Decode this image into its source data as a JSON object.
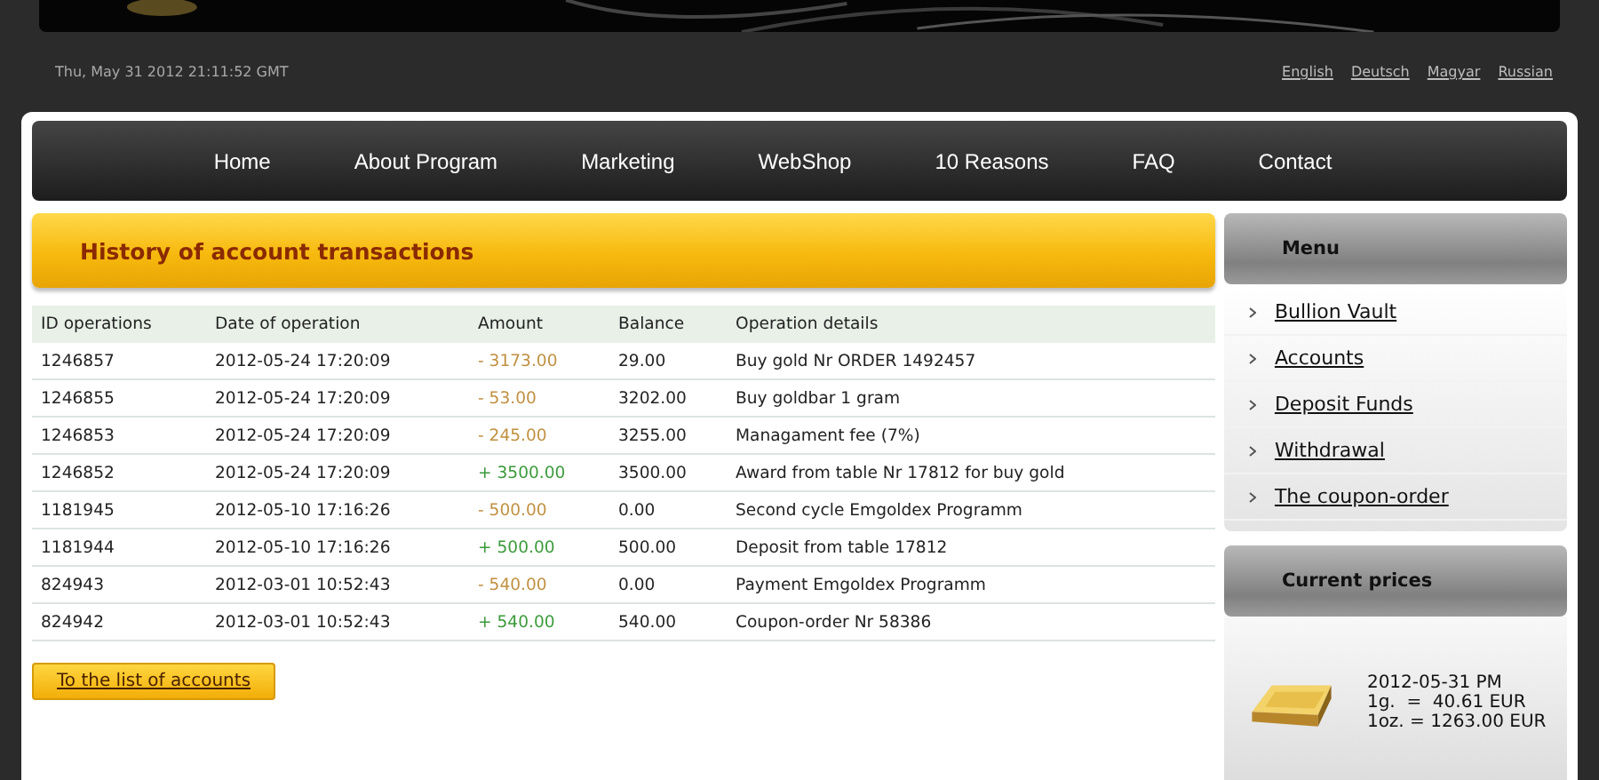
{
  "header": {
    "datetime": "Thu, May 31 2012 21:11:52 GMT",
    "languages": [
      "English",
      "Deutsch",
      "Magyar",
      "Russian"
    ]
  },
  "nav": [
    "Home",
    "About Program",
    "Marketing",
    "WebShop",
    "10 Reasons",
    "FAQ",
    "Contact"
  ],
  "main": {
    "title": "History of account transactions",
    "table": {
      "columns": [
        "ID operations",
        "Date of operation",
        "Amount",
        "Balance",
        "Operation details"
      ],
      "rows": [
        {
          "kind": "debit",
          "cells": [
            "1246857",
            "2012-05-24 17:20:09",
            "- 3173.00",
            "29.00",
            "Buy gold Nr ORDER 1492457"
          ]
        },
        {
          "kind": "debit",
          "cells": [
            "1246855",
            "2012-05-24 17:20:09",
            "- 53.00",
            "3202.00",
            "Buy goldbar 1 gram"
          ]
        },
        {
          "kind": "debit",
          "cells": [
            "1246853",
            "2012-05-24 17:20:09",
            "- 245.00",
            "3255.00",
            "Managament fee (7%)"
          ]
        },
        {
          "kind": "credit",
          "cells": [
            "1246852",
            "2012-05-24 17:20:09",
            "+ 3500.00",
            "3500.00",
            "Award from table Nr 17812 for buy gold"
          ]
        },
        {
          "kind": "debit",
          "cells": [
            "1181945",
            "2012-05-10 17:16:26",
            "- 500.00",
            "0.00",
            "Second cycle Emgoldex Programm"
          ]
        },
        {
          "kind": "credit",
          "cells": [
            "1181944",
            "2012-05-10 17:16:26",
            "+ 500.00",
            "500.00",
            "Deposit from table 17812"
          ]
        },
        {
          "kind": "debit",
          "cells": [
            "824943",
            "2012-03-01 10:52:43",
            "- 540.00",
            "0.00",
            "Payment Emgoldex Programm"
          ]
        },
        {
          "kind": "credit",
          "cells": [
            "824942",
            "2012-03-01 10:52:43",
            "+ 540.00",
            "540.00",
            "Coupon-order Nr 58386"
          ]
        }
      ]
    },
    "button": "To the list of accounts"
  },
  "sidebar": {
    "menu_title": "Menu",
    "menu": [
      "Bullion Vault",
      "Accounts",
      "Deposit Funds",
      "Withdrawal",
      "The coupon-order"
    ],
    "prices_title": "Current prices",
    "prices": [
      "2012-05-31 PM",
      "1g.  =  40.61 EUR",
      "1oz. = 1263.00 EUR"
    ]
  }
}
